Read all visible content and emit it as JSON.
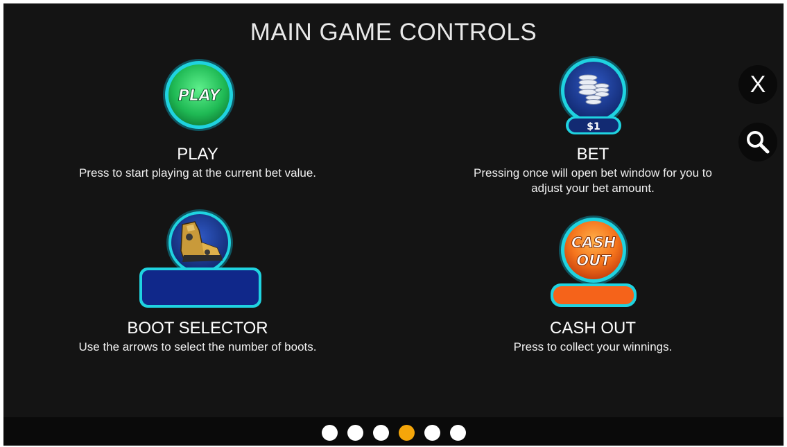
{
  "title": "MAIN GAME CONTROLS",
  "controls": {
    "play": {
      "icon_label": "PLAY",
      "name": "PLAY",
      "desc": "Press to start playing at the current bet value."
    },
    "bet": {
      "icon_value": "$1",
      "name": "BET",
      "desc_line1": "Pressing once will open bet window for you to",
      "desc_line2": "adjust your bet amount."
    },
    "boot": {
      "name": "BOOT SELECTOR",
      "desc": "Use the arrows to select the number of boots."
    },
    "cashout": {
      "icon_line1": "CASH",
      "icon_line2": "OUT",
      "name": "CASH OUT",
      "desc": "Press to collect your winnings."
    }
  },
  "side": {
    "close_label": "X"
  },
  "pagination": {
    "total": 6,
    "active_index": 3
  },
  "colors": {
    "background": "#141414",
    "accent_cyan": "#19c9d6",
    "play_green": "#2fd16a",
    "bet_blue": "#1a3a8c",
    "cashout_orange": "#f5631a",
    "active_dot": "#f5a60a"
  }
}
